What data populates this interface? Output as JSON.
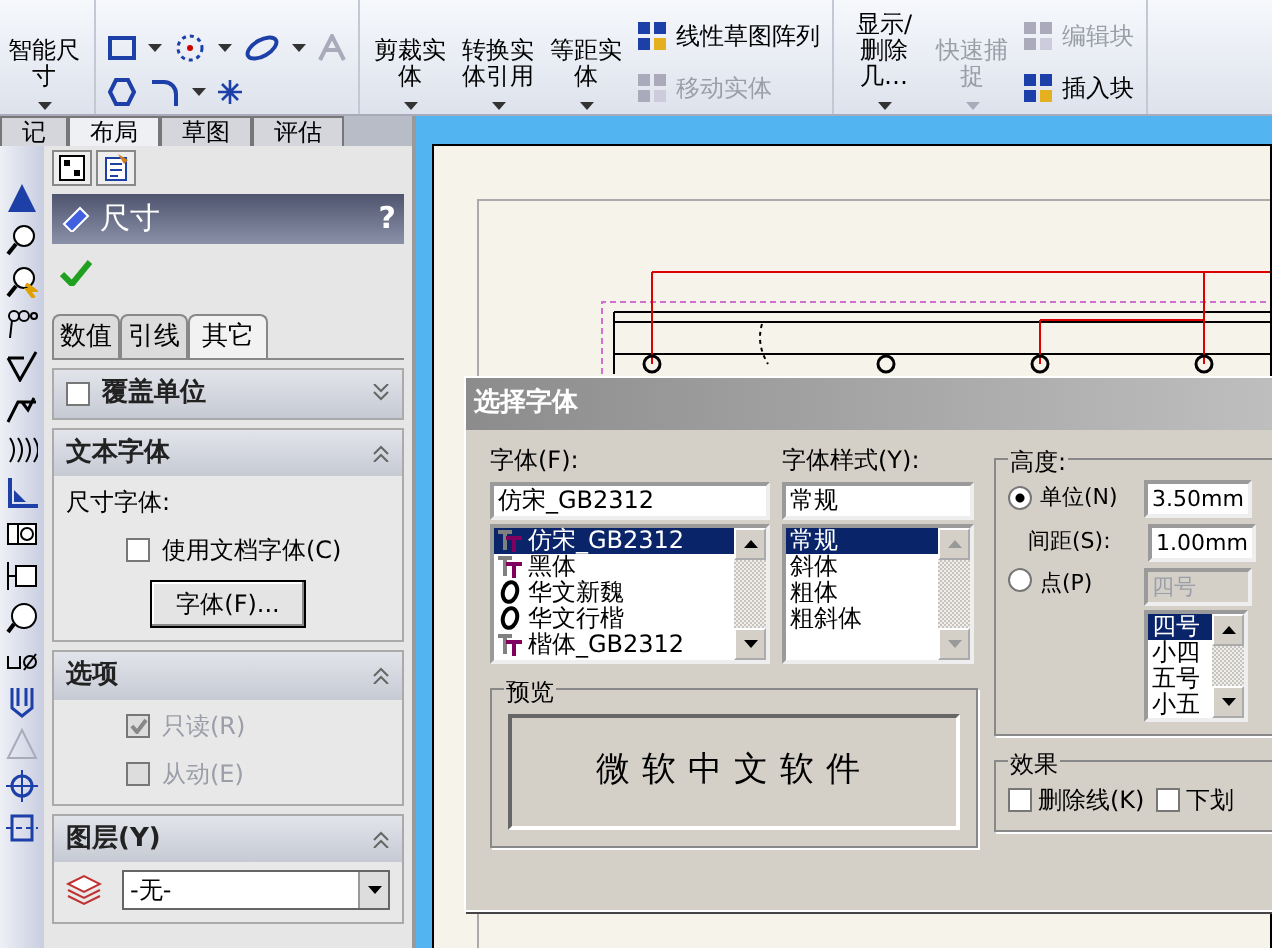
{
  "ribbon": [
    {
      "kind": "large",
      "label": "智能尺寸",
      "disabled": false
    },
    {
      "kind": "icons"
    },
    {
      "kind": "large",
      "label": "剪裁实体",
      "disabled": false
    },
    {
      "kind": "large",
      "label": "转换实体引用",
      "disabled": false
    },
    {
      "kind": "large",
      "label": "等距实体",
      "disabled": false
    },
    {
      "kind": "list",
      "items": [
        {
          "label": "线性草图阵列",
          "disabled": false
        },
        {
          "label": "移动实体",
          "disabled": true
        }
      ]
    },
    {
      "kind": "large",
      "label": "显示/删除几…",
      "disabled": false
    },
    {
      "kind": "large",
      "label": "快速捕捉",
      "disabled": true
    },
    {
      "kind": "list",
      "items": [
        {
          "label": "编辑块",
          "disabled": true
        },
        {
          "label": "插入块",
          "disabled": false
        }
      ]
    }
  ],
  "tabs": [
    {
      "label": "记",
      "selected": false
    },
    {
      "label": "布局",
      "selected": true
    },
    {
      "label": "草图",
      "selected": false
    },
    {
      "label": "评估",
      "selected": false
    }
  ],
  "property_panel": {
    "title": "尺寸",
    "help": "?",
    "subtabs": [
      {
        "label": "数值",
        "selected": false
      },
      {
        "label": "引线",
        "selected": false
      },
      {
        "label": "其它",
        "selected": true
      }
    ],
    "sections": [
      {
        "title": "覆盖单位",
        "expanded": false,
        "checkbox": {
          "checked": false
        }
      },
      {
        "title": "文本字体",
        "expanded": true,
        "items": [
          {
            "kind": "text",
            "label": "尺寸字体:"
          },
          {
            "kind": "checkbox",
            "label": "使用文档字体(C)",
            "checked": false,
            "disabled": false
          },
          {
            "kind": "button",
            "label": "字体(F)..."
          }
        ]
      },
      {
        "title": "选项",
        "expanded": true,
        "items": [
          {
            "kind": "checkbox",
            "label": "只读(R)",
            "checked": true,
            "disabled": true
          },
          {
            "kind": "checkbox",
            "label": "从动(E)",
            "checked": false,
            "disabled": true
          }
        ]
      },
      {
        "title": "图层(Y)",
        "expanded": true,
        "items": [
          {
            "kind": "select",
            "value": "-无-"
          }
        ]
      }
    ]
  },
  "dialog": {
    "title": "选择字体",
    "font": {
      "label": "字体(F):",
      "value": "仿宋_GB2312",
      "options": [
        {
          "label": "仿宋_GB2312",
          "kind": "truetype",
          "selected": true
        },
        {
          "label": "黑体",
          "kind": "truetype",
          "selected": false
        },
        {
          "label": "华文新魏",
          "kind": "opentype",
          "selected": false
        },
        {
          "label": "华文行楷",
          "kind": "opentype",
          "selected": false
        },
        {
          "label": "楷体_GB2312",
          "kind": "truetype",
          "selected": false
        }
      ]
    },
    "style": {
      "label": "字体样式(Y):",
      "value": "常规",
      "options": [
        {
          "label": "常规",
          "selected": true
        },
        {
          "label": "斜体",
          "selected": false
        },
        {
          "label": "粗体",
          "selected": false
        },
        {
          "label": "粗斜体",
          "selected": false
        }
      ]
    },
    "height": {
      "label": "高度:",
      "units": {
        "label": "单位(N)",
        "selected": true,
        "value": "3.50mm"
      },
      "spacing": {
        "label": "间距(S):",
        "value": "1.00mm"
      },
      "points": {
        "label": "点(P)",
        "selected": false,
        "value": "四号",
        "options": [
          {
            "label": "四号",
            "selected": true
          },
          {
            "label": "小四",
            "selected": false
          },
          {
            "label": "五号",
            "selected": false
          },
          {
            "label": "小五",
            "selected": false
          }
        ]
      }
    },
    "preview": {
      "label": "预览",
      "sample": "微软中文软件"
    },
    "effects": {
      "label": "效果",
      "options": [
        {
          "label": "删除线(K)",
          "checked": false
        },
        {
          "label": "下划",
          "checked": false
        }
      ]
    }
  }
}
